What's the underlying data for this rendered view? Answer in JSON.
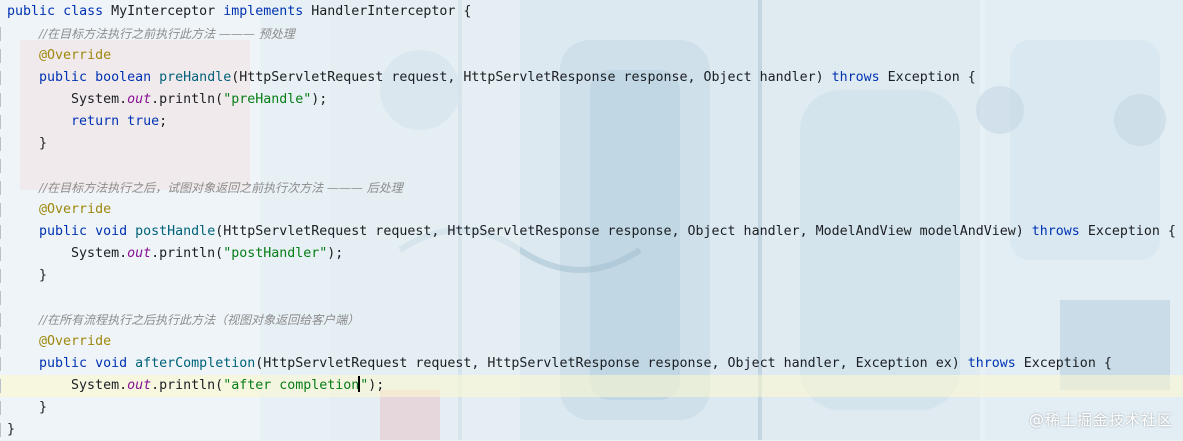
{
  "editor": {
    "lines": [
      [
        "public class MyInterceptor implements HandlerInterceptor {"
      ],
      [
        "    //在目标方法执行之前执行此方法 ——— 预处理"
      ],
      [
        "    @Override"
      ],
      [
        "    public boolean preHandle(HttpServletRequest request, HttpServletResponse response, Object handler) throws Exception {"
      ],
      [
        "        System.out.println(\"preHandle\");"
      ],
      [
        "        return true;"
      ],
      [
        "    }"
      ],
      [
        ""
      ],
      [
        "    //在目标方法执行之后，试图对象返回之前执行次方法 ——— 后处理"
      ],
      [
        "    @Override"
      ],
      [
        "    public void postHandle(HttpServletRequest request, HttpServletResponse response, Object handler, ModelAndView modelAndView) throws Exception {"
      ],
      [
        "        System.out.println(\"postHandler\");"
      ],
      [
        "    }"
      ],
      [
        ""
      ],
      [
        "    //在所有流程执行之后执行此方法（视图对象返回给客户端）"
      ],
      [
        "    @Override"
      ],
      [
        "    public void afterCompletion(HttpServletRequest request, HttpServletResponse response, Object handler, Exception ex) throws Exception {"
      ],
      [
        "        System.out.println(\"after completion\");"
      ],
      [
        "    }"
      ],
      [
        "}"
      ]
    ],
    "tokens": {
      "l0": [
        [
          "kw",
          "public"
        ],
        [
          "",
          " "
        ],
        [
          "kw",
          "class"
        ],
        [
          "",
          " MyInterceptor "
        ],
        [
          "kw",
          "implements"
        ],
        [
          "",
          " HandlerInterceptor {"
        ]
      ],
      "l1": [
        [
          "",
          "    "
        ],
        [
          "cm",
          "//在目标方法执行之前执行此方法 ——— 预处理"
        ]
      ],
      "l2": [
        [
          "",
          "    "
        ],
        [
          "an",
          "@Override"
        ]
      ],
      "l3": [
        [
          "",
          "    "
        ],
        [
          "kw",
          "public"
        ],
        [
          "",
          " "
        ],
        [
          "kw",
          "boolean"
        ],
        [
          "",
          " "
        ],
        [
          "fn",
          "preHandle"
        ],
        [
          "",
          "(HttpServletRequest request, HttpServletResponse response, Object handler) "
        ],
        [
          "kw",
          "throws"
        ],
        [
          "",
          " Exception {"
        ]
      ],
      "l4": [
        [
          "",
          "        System."
        ],
        [
          "it",
          "out"
        ],
        [
          "",
          ".println("
        ],
        [
          "st",
          "\"preHandle\""
        ],
        [
          "",
          ");"
        ]
      ],
      "l5": [
        [
          "",
          "        "
        ],
        [
          "kw",
          "return"
        ],
        [
          "",
          " "
        ],
        [
          "kw",
          "true"
        ],
        [
          "",
          ";"
        ]
      ],
      "l6": [
        [
          "",
          "    }"
        ]
      ],
      "l7": [
        [
          "",
          ""
        ]
      ],
      "l8": [
        [
          "",
          "    "
        ],
        [
          "cm",
          "//在目标方法执行之后，试图对象返回之前执行次方法 ——— 后处理"
        ]
      ],
      "l9": [
        [
          "",
          "    "
        ],
        [
          "an",
          "@Override"
        ]
      ],
      "l10": [
        [
          "",
          "    "
        ],
        [
          "kw",
          "public"
        ],
        [
          "",
          " "
        ],
        [
          "kw",
          "void"
        ],
        [
          "",
          " "
        ],
        [
          "fn",
          "postHandle"
        ],
        [
          "",
          "(HttpServletRequest request, HttpServletResponse response, Object handler, ModelAndView modelAndView) "
        ],
        [
          "kw",
          "throws"
        ],
        [
          "",
          " Exception {"
        ]
      ],
      "l11": [
        [
          "",
          "        System."
        ],
        [
          "it",
          "out"
        ],
        [
          "",
          ".println("
        ],
        [
          "st",
          "\"postHandler\""
        ],
        [
          "",
          ");"
        ]
      ],
      "l12": [
        [
          "",
          "    }"
        ]
      ],
      "l13": [
        [
          "",
          ""
        ]
      ],
      "l14": [
        [
          "",
          "    "
        ],
        [
          "cm",
          "//在所有流程执行之后执行此方法（视图对象返回给客户端）"
        ]
      ],
      "l15": [
        [
          "",
          "    "
        ],
        [
          "an",
          "@Override"
        ]
      ],
      "l16": [
        [
          "",
          "    "
        ],
        [
          "kw",
          "public"
        ],
        [
          "",
          " "
        ],
        [
          "kw",
          "void"
        ],
        [
          "",
          " "
        ],
        [
          "fn",
          "afterCompletion"
        ],
        [
          "",
          "(HttpServletRequest request, HttpServletResponse response, Object handler, Exception ex) "
        ],
        [
          "kw",
          "throws"
        ],
        [
          "",
          " Exception {"
        ]
      ],
      "l17": [
        [
          "",
          "        System."
        ],
        [
          "it",
          "out"
        ],
        [
          "",
          ".println("
        ],
        [
          "st",
          "\"after completion"
        ],
        [
          "caret",
          ""
        ],
        [
          "st",
          "\""
        ],
        [
          "",
          ");"
        ]
      ],
      "l18": [
        [
          "",
          "    }"
        ]
      ],
      "l19": [
        [
          "",
          "}"
        ]
      ]
    },
    "current_line_index": 17
  },
  "watermark": "@稀土掘金技术社区",
  "colors": {
    "keyword": "#0033b3",
    "method": "#00627a",
    "annotation": "#9e880d",
    "string": "#067d17",
    "field": "#871094",
    "comment": "#8c8c8c",
    "current_line": "#fff9cd"
  }
}
